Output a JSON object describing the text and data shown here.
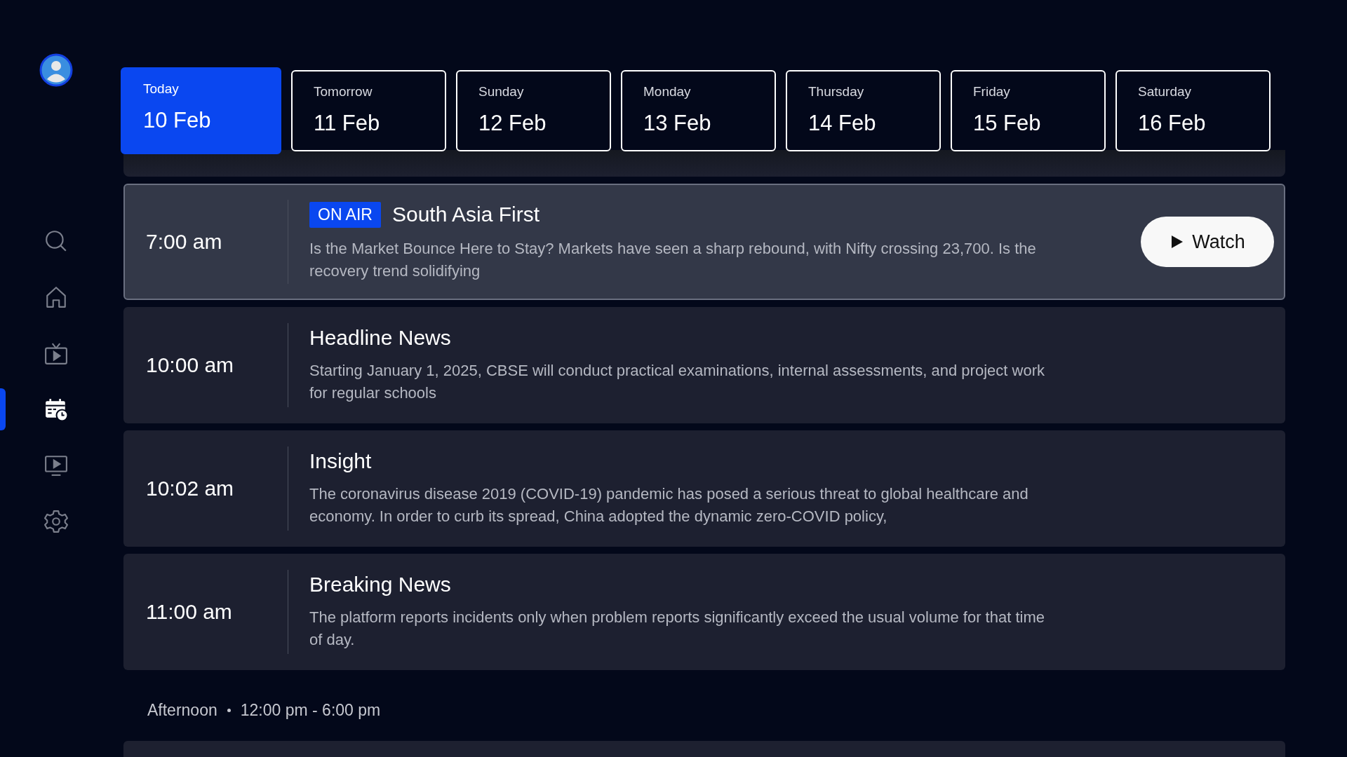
{
  "sidebar": {
    "items": [
      {
        "kind": "search",
        "selected": false
      },
      {
        "kind": "home",
        "selected": false
      },
      {
        "kind": "live-tv",
        "selected": false
      },
      {
        "kind": "schedule",
        "selected": true
      },
      {
        "kind": "video",
        "selected": false
      },
      {
        "kind": "settings",
        "selected": false
      }
    ]
  },
  "date_tabs": [
    {
      "day": "Today",
      "date": "10 Feb",
      "selected": true
    },
    {
      "day": "Tomorrow",
      "date": "11 Feb",
      "selected": false
    },
    {
      "day": "Sunday",
      "date": "12 Feb",
      "selected": false
    },
    {
      "day": "Monday",
      "date": "13 Feb",
      "selected": false
    },
    {
      "day": "Thursday",
      "date": "14 Feb",
      "selected": false
    },
    {
      "day": "Friday",
      "date": "15 Feb",
      "selected": false
    },
    {
      "day": "Saturday",
      "date": "16 Feb",
      "selected": false
    }
  ],
  "programs": [
    {
      "time": "7:00 am",
      "on_air": true,
      "badge": "ON AIR",
      "title": "South Asia First",
      "description": "Is the Market Bounce Here to Stay? Markets have seen a sharp rebound, with Nifty crossing 23,700. Is the recovery trend solidifying",
      "action": "Watch"
    },
    {
      "time": "10:00 am",
      "on_air": false,
      "title": "Headline News",
      "description": "Starting January 1, 2025, CBSE will conduct practical examinations, internal assessments, and project work for regular schools"
    },
    {
      "time": "10:02 am",
      "on_air": false,
      "title": "Insight",
      "description": "The coronavirus disease 2019 (COVID-19) pandemic has posed a serious threat to global healthcare and economy. In order to curb its spread, China adopted the dynamic zero-COVID policy,"
    },
    {
      "time": "11:00 am",
      "on_air": false,
      "title": "Breaking News",
      "description": "The platform reports incidents only when problem reports significantly exceed the usual volume for that time of day."
    }
  ],
  "section": {
    "name": "Afternoon",
    "range": "12:00 pm - 6:00 pm"
  }
}
